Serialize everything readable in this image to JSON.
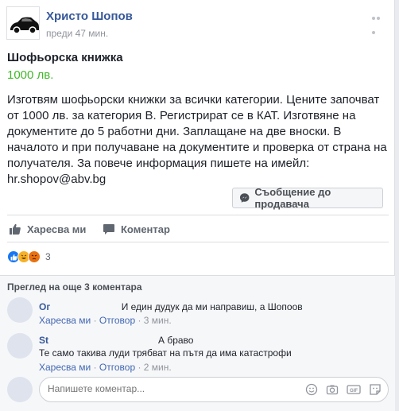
{
  "post": {
    "author": "Христо Шопов",
    "time": "преди 47 мин.",
    "title": "Шофьорска книжка",
    "price": "1000 лв.",
    "description": "Изготвям шофьорски книжки за всички категории. Цените започват от 1000 лв. за категория В. Регистрират се в КАТ. Изготвяне на документите до 5 работни дни. Заплащане на две вноски. В началото и при получаване на документите и проверка от страна на получателя. За повече информация пишете на имейл: hr.shopov@abv.bg",
    "message_button": "Съобщение до продавача"
  },
  "actions": {
    "like": "Харесва ми",
    "comment": "Коментар"
  },
  "reactions": {
    "icons": [
      "like-reaction-icon",
      "haha-reaction-icon",
      "angry-reaction-icon"
    ],
    "count": "3"
  },
  "comments": {
    "more_label": "Преглед на още 3 коментара",
    "items": [
      {
        "name": "Ог",
        "text": "И един дудук да ми направиш, а Шопоов",
        "like": "Харесва ми",
        "reply": "Отговор",
        "time": "3 мин."
      },
      {
        "name": "St",
        "text_first": "А браво",
        "text": "Те само такива луди трябват на пътя да има катастрофи",
        "like": "Харесва ми",
        "reply": "Отговор",
        "time": "2 мин."
      }
    ],
    "input_placeholder": "Напишете коментар..."
  },
  "colors": {
    "link": "#365899",
    "price": "#42b72a",
    "muted": "#90949c"
  }
}
